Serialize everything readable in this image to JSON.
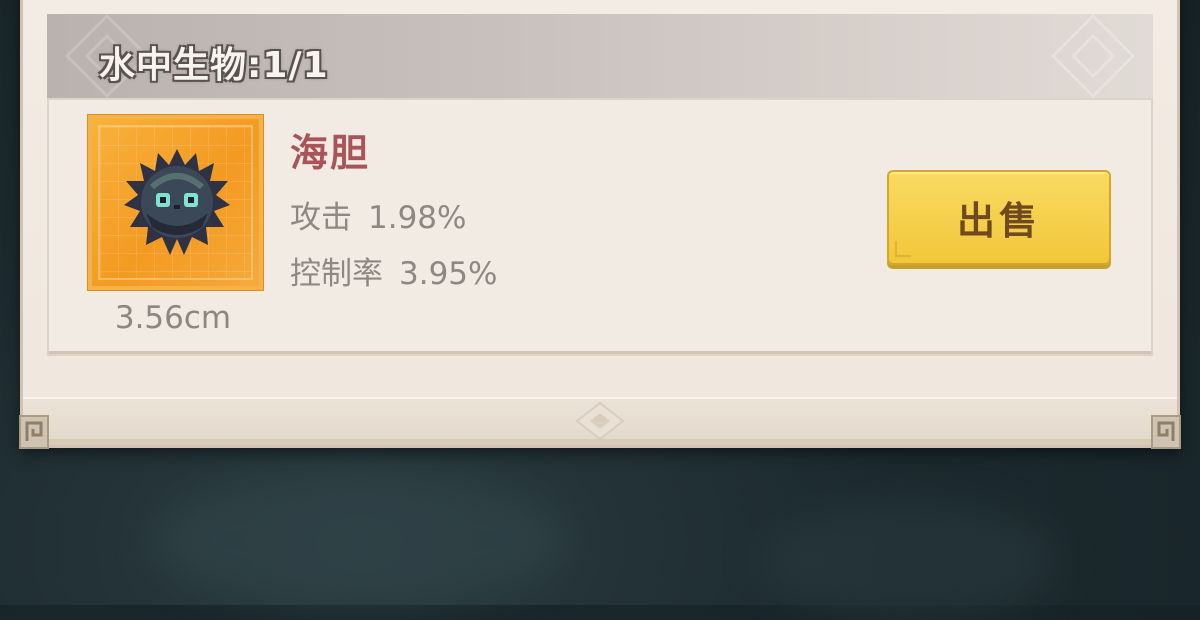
{
  "section": {
    "title": "水中生物:1/1"
  },
  "item": {
    "name": "海胆",
    "icon": "sea-urchin-icon",
    "size": "3.56cm",
    "stats": [
      {
        "label": "攻击",
        "value": "1.98%"
      },
      {
        "label": "控制率",
        "value": "3.95%"
      }
    ],
    "sell_label": "出售"
  },
  "colors": {
    "name_color": "#a9545a",
    "button_color": "#f2c739",
    "icon_frame_color": "#f39a22",
    "panel_bg": "#f2ebe3"
  }
}
